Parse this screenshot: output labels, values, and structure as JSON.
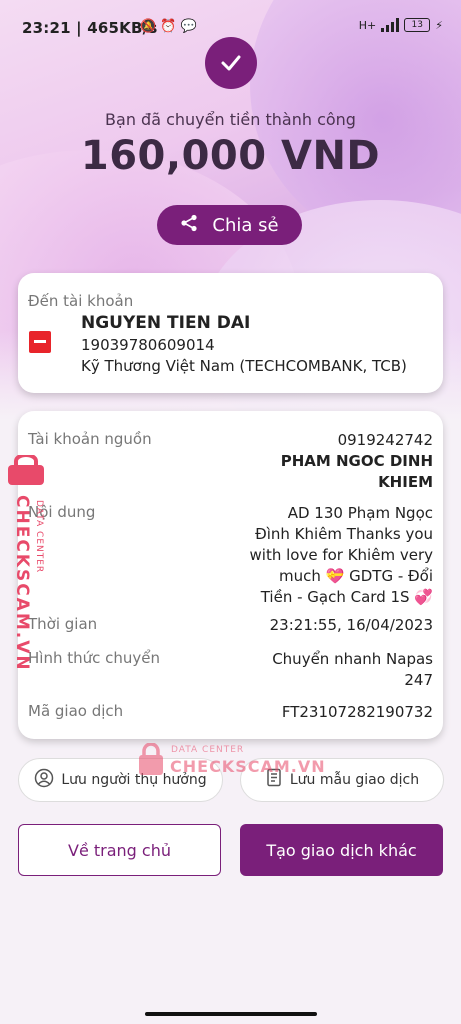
{
  "status_bar": {
    "time_text": "23:21 | 465KB/s",
    "network": "H+",
    "battery": "13"
  },
  "header": {
    "success_text": "Bạn đã chuyển tiền thành công",
    "amount": "160,000 VND",
    "share_label": "Chia sẻ"
  },
  "recipient": {
    "label": "Đến tài khoản",
    "name": "NGUYEN TIEN DAI",
    "account_number": "19039780609014",
    "bank": "Kỹ Thương Việt Nam (TECHCOMBANK, TCB)"
  },
  "details": {
    "source_label": "Tài khoản nguồn",
    "source_account": "0919242742",
    "source_name_line1": "PHAM NGOC DINH",
    "source_name_line2": "KHIEM",
    "content_label": "Nội dung",
    "content_line1": "AD 130 Phạm Ngọc",
    "content_line2": "Đình Khiêm Thanks you",
    "content_line3": "with love for Khiêm very",
    "content_line4": "much 💝 GDTG - Đổi",
    "content_line5": "Tiền - Gạch Card 1S 💞",
    "time_label": "Thời gian",
    "time_value": "23:21:55, 16/04/2023",
    "method_label": "Hình thức chuyển",
    "method_line1": "Chuyển nhanh Napas",
    "method_line2": "247",
    "code_label": "Mã giao dịch",
    "code_value": "FT23107282190732"
  },
  "actions": {
    "save_beneficiary": "Lưu người thụ hưởng",
    "save_template": "Lưu mẫu giao dịch",
    "home": "Về trang chủ",
    "new_transaction": "Tạo giao dịch khác"
  },
  "watermark": {
    "brand": "CHECKSCAM.VN",
    "tag": "DATA CENTER"
  },
  "colors": {
    "primary": "#7a1f7a",
    "watermark": "#e84a6a"
  }
}
